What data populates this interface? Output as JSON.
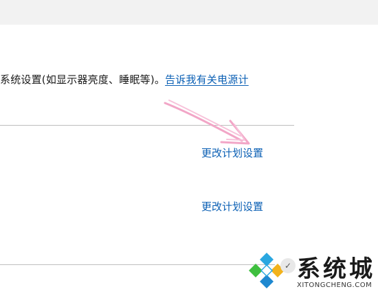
{
  "description": {
    "text": "系统设置(如显示器亮度、睡眠等)。",
    "link_label": "告诉我有关电源计"
  },
  "plans": [
    {
      "change_label": "更改计划设置"
    },
    {
      "change_label": "更改计划设置"
    }
  ],
  "watermark": {
    "title": "系统城",
    "subtitle": "XITONGCHENG.COM",
    "badge": "✓"
  },
  "colors": {
    "link": "#0a5fb4",
    "arrow": "#f2a6c7",
    "divider": "#bdbdbd"
  }
}
